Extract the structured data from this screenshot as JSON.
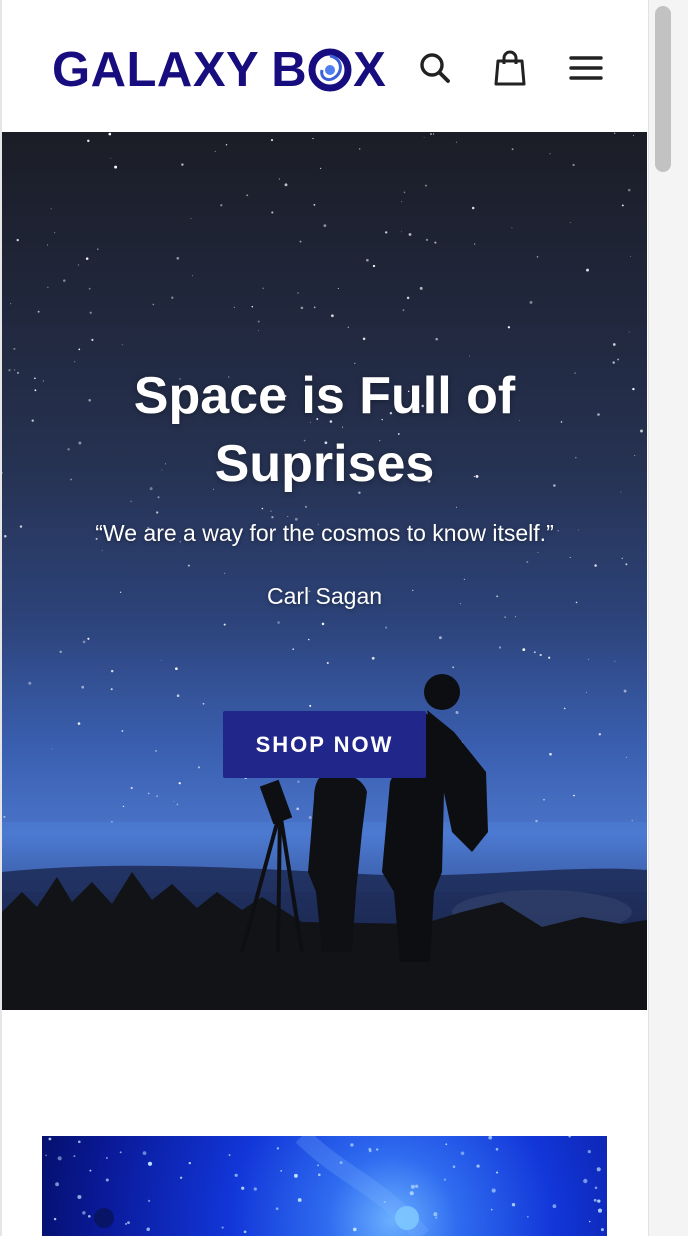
{
  "header": {
    "logo_text_left": "GALAXY",
    "logo_text_b": "B",
    "logo_text_x": "X",
    "search_icon": "search-icon",
    "cart_icon": "shopping-bag-icon",
    "menu_icon": "hamburger-menu-icon"
  },
  "hero": {
    "title": "Space is Full of Suprises",
    "quote": "“We are a way for the cosmos to know itself.”",
    "author": "Carl Sagan",
    "cta_label": "SHOP NOW"
  },
  "colors": {
    "brand": "#170d7e",
    "button": "#21268a"
  }
}
